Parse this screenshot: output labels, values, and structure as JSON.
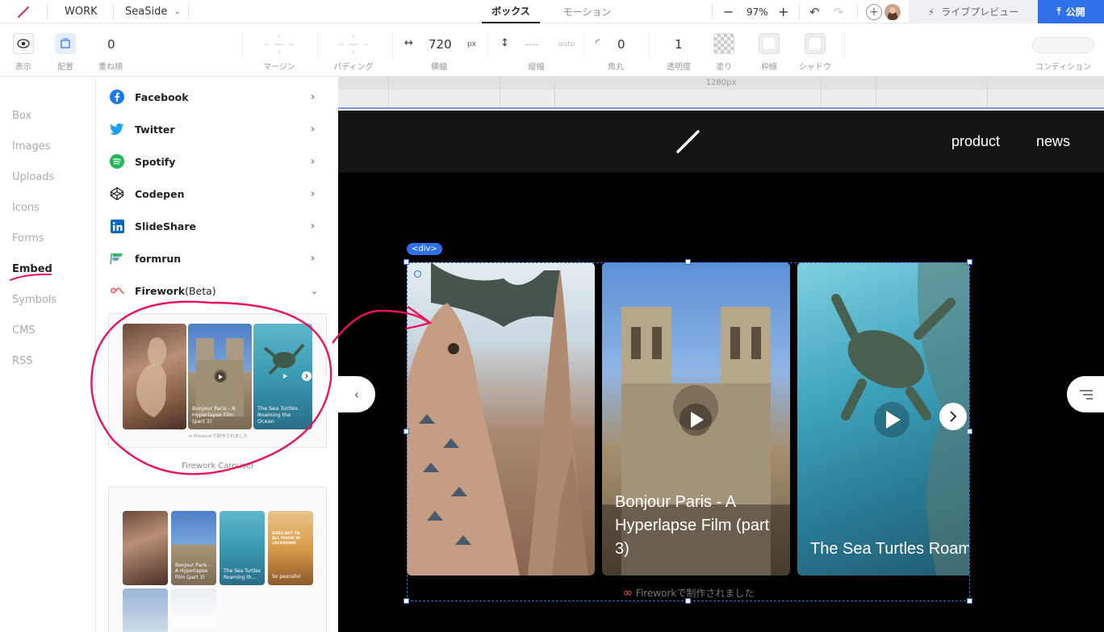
{
  "topbar": {
    "workspace": "WORK",
    "project": "SeaSide",
    "tabs": [
      {
        "label": "ボックス"
      },
      {
        "label": "モーション"
      }
    ],
    "zoom": "97%",
    "live_preview": "ライブプレビュー",
    "publish": "公開"
  },
  "props": {
    "display_label": "表示",
    "placement_label": "配置",
    "zorder_value": "0",
    "zorder_label": "重ね順",
    "margin_label": "マージン",
    "padding_label": "パディング",
    "width_value": "720",
    "width_unit": "px",
    "width_label": "横幅",
    "height_value": "----",
    "height_unit": "auto",
    "height_label": "縦幅",
    "radius_value": "0",
    "radius_label": "角丸",
    "opacity_value": "1",
    "opacity_label": "透明度",
    "fill_label": "塗り",
    "border_label": "枠線",
    "shadow_label": "シャドウ",
    "condition_label": "コンディション"
  },
  "leftnav": {
    "items": [
      {
        "label": "Box"
      },
      {
        "label": "Images"
      },
      {
        "label": "Uploads"
      },
      {
        "label": "Icons"
      },
      {
        "label": "Forms"
      },
      {
        "label": "Embed"
      },
      {
        "label": "Symbols"
      },
      {
        "label": "CMS"
      },
      {
        "label": "RSS"
      }
    ],
    "active": "Embed"
  },
  "embed": {
    "items": [
      {
        "label": "Facebook",
        "icon": "facebook-icon",
        "color": "#1877f2"
      },
      {
        "label": "Twitter",
        "icon": "twitter-icon",
        "color": "#1da1f2"
      },
      {
        "label": "Spotify",
        "icon": "spotify-icon",
        "color": "#1db954"
      },
      {
        "label": "Codepen",
        "icon": "codepen-icon",
        "color": "#222222"
      },
      {
        "label": "SlideShare",
        "icon": "slideshare-icon",
        "color": "#0a66c2"
      },
      {
        "label": "formrun",
        "icon": "formrun-icon",
        "color": "#3cb371"
      }
    ],
    "firework_label": "Firework",
    "firework_suffix": "(Beta)",
    "carousel_card": {
      "caption": "Firework Carousel",
      "tile2": "Bonjour Paris - A Hyperlapse Film (part 3)",
      "tile3": "The Sea Turtles Roaming the Ocean",
      "footer": "Fireworkで制作されました"
    },
    "grid_card": {
      "tile2": "Bonjour Paris - A Hyperlapse Film (part 3)",
      "tile3": "The Sea Turtles Roaming th...",
      "tile4_overlay": "GOES OUT TO ALL THOSE IN LOCKDOWN",
      "tile4": "So peaceful"
    }
  },
  "canvas": {
    "ruler_label": "1280px",
    "nav": {
      "product": "product",
      "news": "news"
    },
    "selection_tag": "<div>",
    "slides": [
      {
        "title": ""
      },
      {
        "title": "Bonjour Paris - A Hyperlapse Film (part 3)"
      },
      {
        "title": "The Sea Turtles Roaming the Ocean"
      }
    ],
    "footer": "Fireworkで制作されました"
  },
  "colors": {
    "accent": "#2f6fe8",
    "annotation": "#e8145a",
    "firework": "#f0564a"
  }
}
